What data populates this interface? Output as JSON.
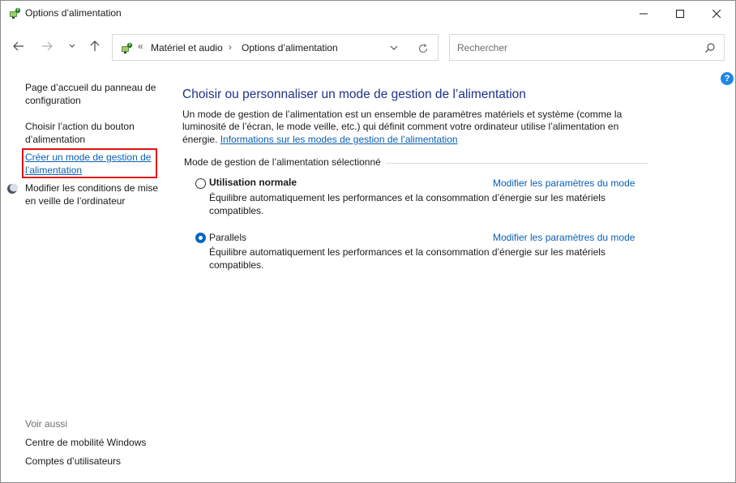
{
  "window": {
    "title": "Options d’alimentation",
    "controls": {
      "minimize": "minimize",
      "maximize": "maximize",
      "close": "close"
    }
  },
  "address": {
    "chevrons": "«",
    "crumbs": [
      "Matériel et audio",
      "Options d’alimentation"
    ],
    "separator": "›"
  },
  "search": {
    "placeholder": "Rechercher"
  },
  "help": {
    "label": "?"
  },
  "left_pane": {
    "home": "Page d’accueil du panneau de configuration",
    "choose_button": "Choisir l’action du bouton d’alimentation",
    "create_plan": "Créer un mode de gestion de l’alimentation",
    "modify_sleep": "Modifier les conditions de mise en veille de l’ordinateur",
    "see_also": "Voir aussi",
    "mobility_center": "Centre de mobilité Windows",
    "user_accounts": "Comptes d’utilisateurs"
  },
  "main": {
    "title": "Choisir ou personnaliser un mode de gestion de l’alimentation",
    "description": "Un mode de gestion de l’alimentation est un ensemble de paramètres matériels et système (comme la luminosité de l’écran, le mode veille, etc.) qui définit comment votre ordinateur utilise l’alimentation en énergie.",
    "info_link": "Informations sur les modes de gestion de l’alimentation",
    "section_label": "Mode de gestion de l’alimentation sélectionné",
    "plans": [
      {
        "name": "Utilisation normale",
        "selected": false,
        "change_link": "Modifier les paramètres du mode",
        "description": "Équilibre automatiquement les performances et la consommation d’énergie sur les matériels compatibles."
      },
      {
        "name": "Parallels",
        "selected": true,
        "change_link": "Modifier les paramètres du mode",
        "description": "Équilibre automatiquement les performances et la consommation d’énergie sur les matériels compatibles."
      }
    ]
  },
  "colors": {
    "title_blue": "#1e3287",
    "link_blue": "#0a5fb4",
    "highlight_red": "#e01010",
    "radio_blue": "#0067c0"
  }
}
